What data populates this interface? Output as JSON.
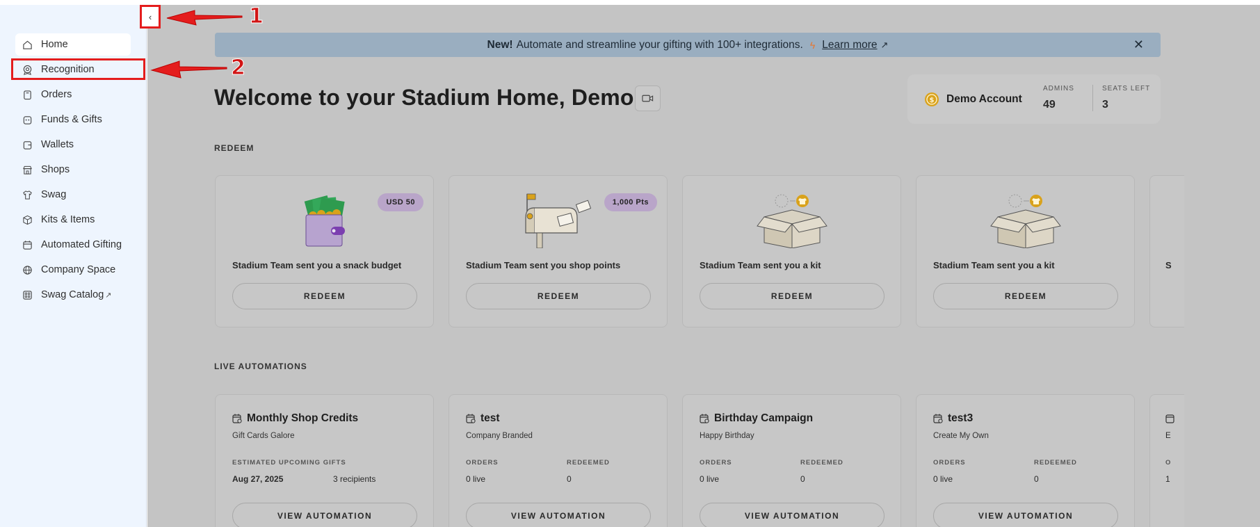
{
  "sidebar": {
    "items": [
      {
        "label": "Home",
        "icon": "home-icon"
      },
      {
        "label": "Recognition",
        "icon": "recognition-icon"
      },
      {
        "label": "Orders",
        "icon": "orders-icon"
      },
      {
        "label": "Funds & Gifts",
        "icon": "funds-icon"
      },
      {
        "label": "Wallets",
        "icon": "wallet-icon"
      },
      {
        "label": "Shops",
        "icon": "shop-icon"
      },
      {
        "label": "Swag",
        "icon": "shirt-icon"
      },
      {
        "label": "Kits & Items",
        "icon": "box-icon"
      },
      {
        "label": "Automated Gifting",
        "icon": "calendar-icon"
      },
      {
        "label": "Company Space",
        "icon": "globe-icon"
      },
      {
        "label": "Swag Catalog",
        "icon": "catalog-icon"
      }
    ],
    "active": "Home",
    "collapse_glyph": "‹"
  },
  "banner": {
    "new_label": "New!",
    "text": "Automate and streamline your gifting with 100+ integrations.",
    "link": "Learn more",
    "close": "✕"
  },
  "welcome": "Welcome to your Stadium Home, Demo!",
  "account": {
    "name": "Demo Account",
    "admins_label": "ADMINS",
    "admins_value": "49",
    "seats_label": "SEATS LEFT",
    "seats_value": "3"
  },
  "redeem": {
    "section_title": "REDEEM",
    "cards": [
      {
        "badge": "USD 50",
        "message": "Stadium Team sent you a snack budget",
        "button": "REDEEM",
        "illustration": "wallet-money"
      },
      {
        "badge": "1,000 Pts",
        "message": "Stadium Team sent you shop points",
        "button": "REDEEM",
        "illustration": "mailbox"
      },
      {
        "badge": "",
        "message": "Stadium Team sent you a kit",
        "button": "REDEEM",
        "illustration": "kit-box"
      },
      {
        "badge": "",
        "message": "Stadium Team sent you a kit",
        "button": "REDEEM",
        "illustration": "kit-box"
      }
    ],
    "clipped_text": "S"
  },
  "automations": {
    "section_title": "LIVE AUTOMATIONS",
    "cards": [
      {
        "title": "Monthly Shop Credits",
        "subtitle": "Gift Cards Galore",
        "label1": "ESTIMATED UPCOMING GIFTS",
        "val1": "Aug 27, 2025",
        "label2": "",
        "val2": "3 recipients",
        "button": "VIEW AUTOMATION"
      },
      {
        "title": "test",
        "subtitle": "Company Branded",
        "label1": "ORDERS",
        "val1": "0 live",
        "label2": "REDEEMED",
        "val2": "0",
        "button": "VIEW AUTOMATION"
      },
      {
        "title": "Birthday Campaign",
        "subtitle": "Happy Birthday",
        "label1": "ORDERS",
        "val1": "0 live",
        "label2": "REDEEMED",
        "val2": "0",
        "button": "VIEW AUTOMATION"
      },
      {
        "title": "test3",
        "subtitle": "Create My Own",
        "label1": "ORDERS",
        "val1": "0 live",
        "label2": "REDEEMED",
        "val2": "0",
        "button": "VIEW AUTOMATION"
      }
    ],
    "clipped_sub": "E",
    "clipped_label": "O",
    "clipped_val": "1"
  },
  "annotations": [
    {
      "number": "1",
      "color": "#e41d1d"
    },
    {
      "number": "2",
      "color": "#e41d1d"
    }
  ],
  "colors": {
    "sidebar_bg": "#eef5fe",
    "overlay": "#c4c4c4",
    "banner_bg": "#9aaec0",
    "badge": "#b9a5c9",
    "annotation": "#e41d1d",
    "coin": "#d9a21b"
  }
}
